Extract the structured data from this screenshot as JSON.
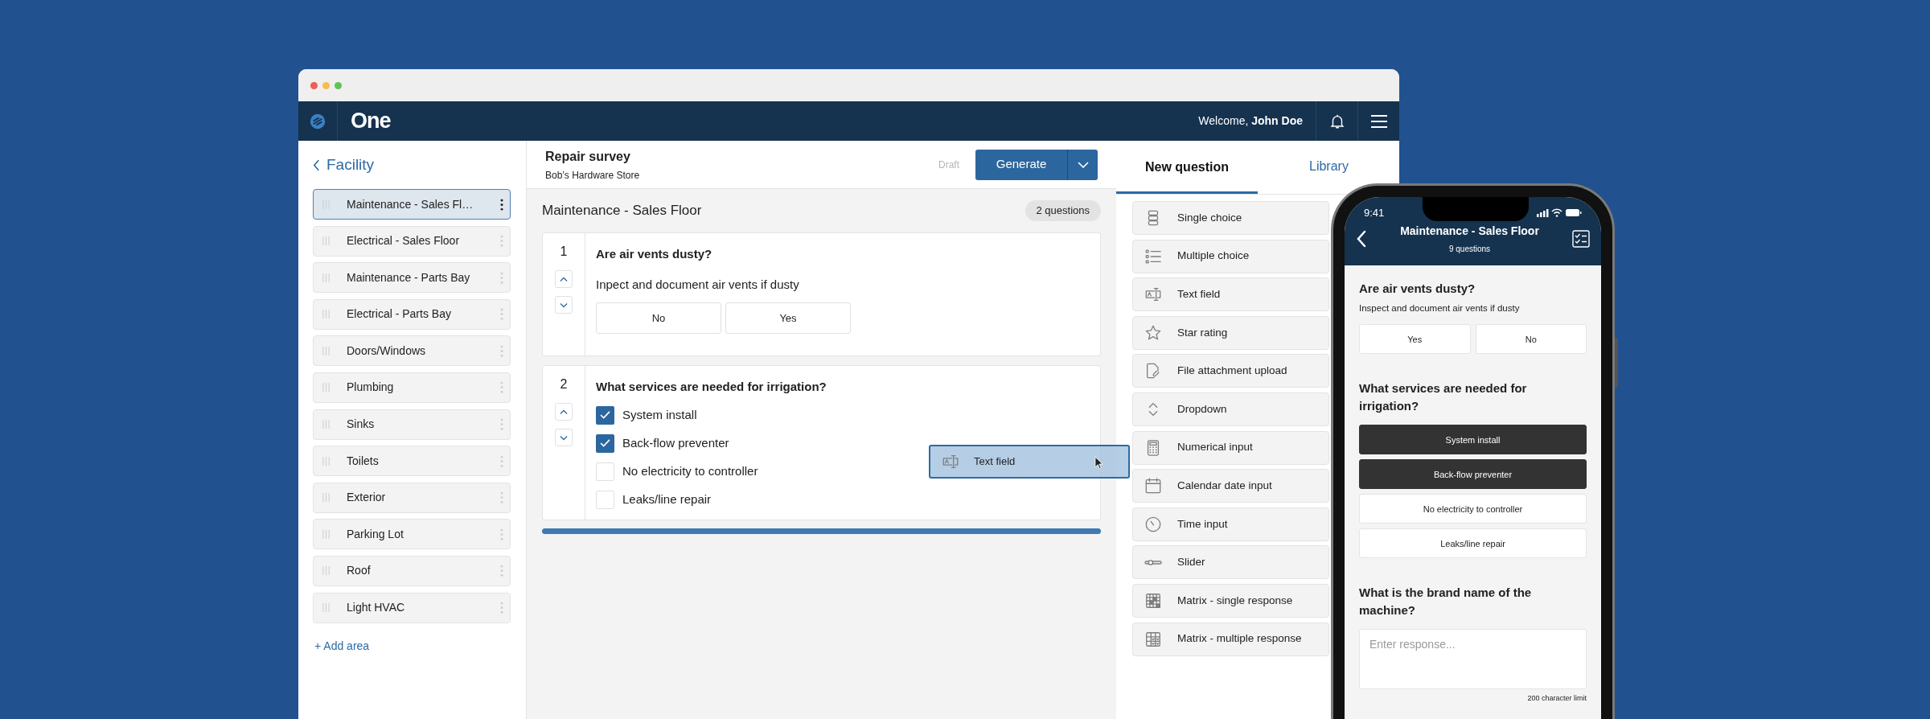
{
  "browser": {
    "brand": "One",
    "welcome": "Welcome, **John Doe**"
  },
  "sidebar": {
    "back": "Facility",
    "add": "+ Add area",
    "items": [
      {
        "label": "Maintenance - Sales Fl…",
        "selected": true
      },
      {
        "label": "Electrical - Sales Floor",
        "selected": false
      },
      {
        "label": "Maintenance - Parts Bay",
        "selected": false
      },
      {
        "label": "Electrical - Parts Bay",
        "selected": false
      },
      {
        "label": "Doors/Windows",
        "selected": false
      },
      {
        "label": "Plumbing",
        "selected": false
      },
      {
        "label": "Sinks",
        "selected": false
      },
      {
        "label": "Toilets",
        "selected": false
      },
      {
        "label": "Exterior",
        "selected": false
      },
      {
        "label": "Parking Lot",
        "selected": false
      },
      {
        "label": "Roof",
        "selected": false
      },
      {
        "label": "Light HVAC",
        "selected": false
      }
    ]
  },
  "survey": {
    "title": "Repair survey",
    "store": "Bob’s Hardware Store",
    "status": "Draft",
    "generate": "Generate"
  },
  "section": {
    "title": "Maintenance - Sales Floor",
    "count": "2 questions"
  },
  "questions": [
    {
      "number": "1",
      "kind": "buttons",
      "title": "Are air vents dusty?",
      "description": "Inpect and document air vents if dusty",
      "options": [
        {
          "label": "No"
        },
        {
          "label": "Yes"
        }
      ]
    },
    {
      "number": "2",
      "kind": "checkboxes",
      "title": "What services are needed for irrigation?",
      "options": [
        {
          "label": "System install",
          "checked": true
        },
        {
          "label": "Back-flow preventer",
          "checked": true
        },
        {
          "label": "No electricity to controller",
          "checked": false
        },
        {
          "label": "Leaks/line repair",
          "checked": false
        }
      ]
    }
  ],
  "tabs": [
    {
      "label": "New question",
      "selected": true
    },
    {
      "label": "Library",
      "selected": false
    }
  ],
  "question_types": [
    {
      "kind": "single",
      "label": "Single choice"
    },
    {
      "kind": "multiple",
      "label": "Multiple choice"
    },
    {
      "kind": "text",
      "label": "Text field"
    },
    {
      "kind": "star",
      "label": "Star rating"
    },
    {
      "kind": "file",
      "label": "File attachment upload"
    },
    {
      "kind": "dropdown",
      "label": "Dropdown"
    },
    {
      "kind": "number",
      "label": "Numerical input"
    },
    {
      "kind": "date",
      "label": "Calendar date input"
    },
    {
      "kind": "time",
      "label": "Time input"
    },
    {
      "kind": "slider",
      "label": "Slider"
    },
    {
      "kind": "matrixsingle",
      "label": "Matrix - single response"
    },
    {
      "kind": "matrixmulti",
      "label": "Matrix - multiple response"
    }
  ],
  "drag_ghost": {
    "kind": "text",
    "label": "Text field"
  },
  "phone": {
    "time": "9:41",
    "title": "Maintenance - Sales Floor",
    "subtitle": "9 questions",
    "questions": [
      {
        "kind": "buttons",
        "title": "Are air vents dusty?",
        "description": "Inspect and document air vents if dusty",
        "options": [
          {
            "label": "Yes",
            "selected": false
          },
          {
            "label": "No",
            "selected": false
          }
        ]
      },
      {
        "kind": "multi",
        "title": "What services are needed for irrigation?",
        "options": [
          {
            "label": "System install",
            "selected": true
          },
          {
            "label": "Back-flow preventer",
            "selected": true
          },
          {
            "label": "No electricity to controller",
            "selected": false
          },
          {
            "label": "Leaks/line repair",
            "selected": false
          }
        ]
      },
      {
        "kind": "text",
        "title": "What is the brand name of the machine?",
        "placeholder": "Enter response...",
        "limit": "200 character limit"
      }
    ]
  }
}
